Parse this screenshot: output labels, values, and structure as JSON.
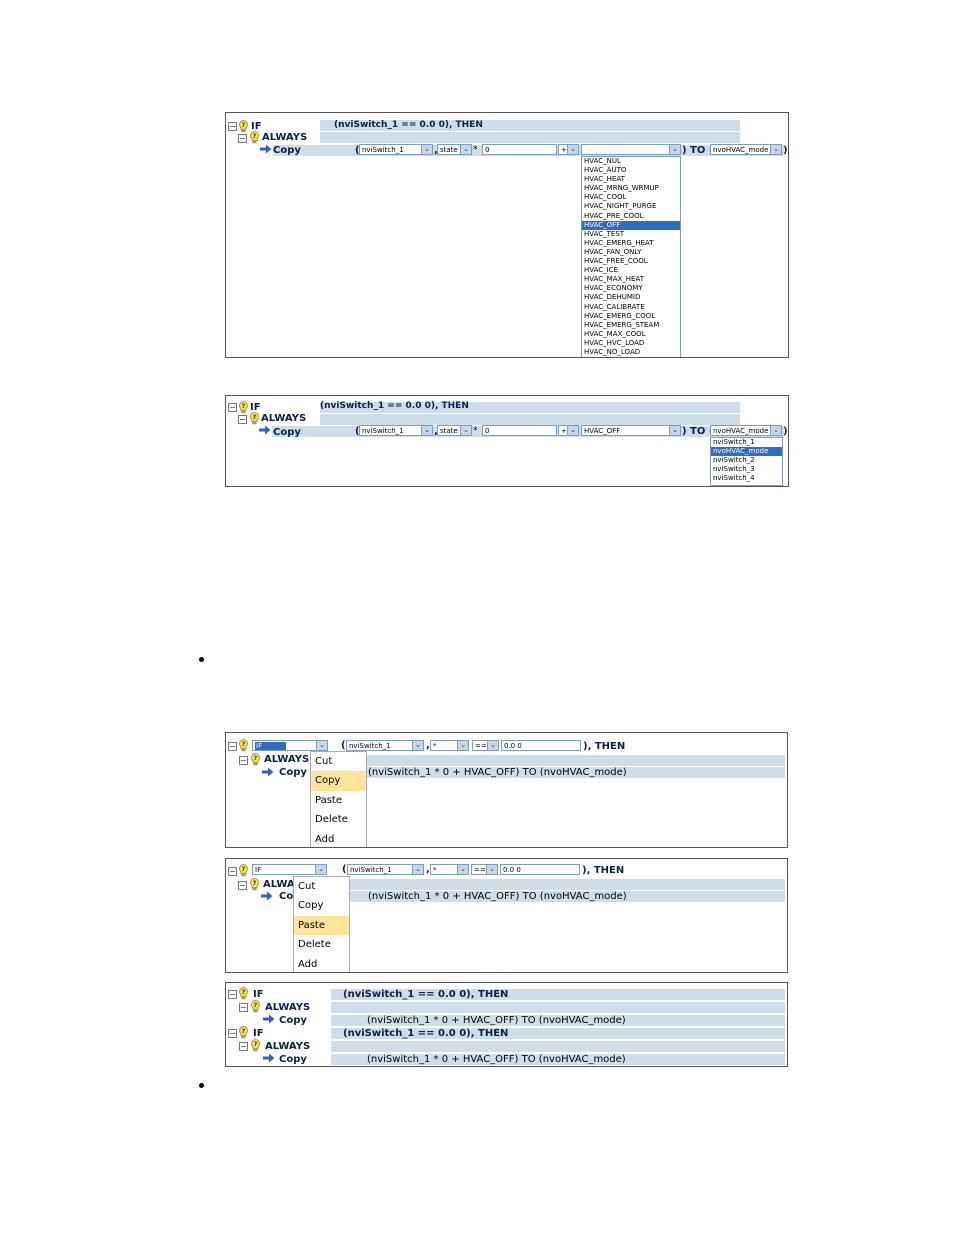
{
  "icons": {
    "bulb": "lightbulb-question-icon",
    "arrow": "arrow-right-icon",
    "expander": "collapse-minus-icon"
  },
  "colors": {
    "bar": "#cfdde8",
    "highlight": "#316ac5",
    "menu_highlight": "#ffe49c"
  },
  "p1": {
    "if_kw": "IF",
    "cond": "(nviSwitch_1 == 0.0 0), THEN",
    "always_kw": "ALWAYS",
    "copy_kw": "Copy",
    "open_paren": "(",
    "var": "nviSwitch_1",
    "comma": ",",
    "field": "state",
    "op1": "*",
    "num": "0",
    "op2": "+",
    "val": "",
    "to": ") TO (",
    "target": "nvoHVAC_mode",
    "close": ")",
    "options": [
      "HVAC_NUL",
      "HVAC_AUTO",
      "HVAC_HEAT",
      "HVAC_MRNG_WRMUP",
      "HVAC_COOL",
      "HVAC_NIGHT_PURGE",
      "HVAC_PRE_COOL",
      "HVAC_OFF",
      "HVAC_TEST",
      "HVAC_EMERG_HEAT",
      "HVAC_FAN_ONLY",
      "HVAC_FREE_COOL",
      "HVAC_ICE",
      "HVAC_MAX_HEAT",
      "HVAC_ECONOMY",
      "HVAC_DEHUMID",
      "HVAC_CALIBRATE",
      "HVAC_EMERG_COOL",
      "HVAC_EMERG_STEAM",
      "HVAC_MAX_COOL",
      "HVAC_HVC_LOAD",
      "HVAC_NO_LOAD"
    ]
  },
  "p2": {
    "if_kw": "IF",
    "cond": "(nviSwitch_1 == 0.0 0), THEN",
    "always_kw": "ALWAYS",
    "copy_kw": "Copy",
    "open_paren": "(",
    "var": "nviSwitch_1",
    "comma": ",",
    "field": "state",
    "op1": "*",
    "num": "0",
    "op2": "+",
    "val": "HVAC_OFF",
    "to": ") TO (",
    "target": "nvoHVAC_mode",
    "close": ")",
    "options": [
      "nviSwitch_1",
      "nvoHVAC_mode",
      "nviSwitch_2",
      "nviSwitch_3",
      "nviSwitch_4"
    ]
  },
  "p3": {
    "if_sel": "IF",
    "open_paren": "(",
    "var": "nviSwitch_1",
    "comma": ",",
    "field": "*",
    "op": "==",
    "num": "0.0 0",
    "then": "), THEN",
    "always_kw": "ALWAYS",
    "copy_kw": "Copy",
    "expr": "(nviSwitch_1 * 0 + HVAC_OFF) TO (nvoHVAC_mode)",
    "menu": [
      "Cut",
      "Copy",
      "Paste",
      "Delete",
      "Add"
    ]
  },
  "p4": {
    "if_sel": "IF",
    "open_paren": "(",
    "var": "nviSwitch_1",
    "comma": ",",
    "field": "*",
    "op": "==",
    "num": "0.0 0",
    "then": "), THEN",
    "always_kw": "ALWA",
    "copy_kw": "Co",
    "expr": "(nviSwitch_1 * 0 + HVAC_OFF) TO (nvoHVAC_mode)",
    "menu": [
      "Cut",
      "Copy",
      "Paste",
      "Delete",
      "Add"
    ]
  },
  "p5": {
    "if_kw": "IF",
    "cond": "(nviSwitch_1 == 0.0 0), THEN",
    "always_kw": "ALWAYS",
    "copy_kw": "Copy",
    "expr": "(nviSwitch_1 * 0 + HVAC_OFF) TO (nvoHVAC_mode)"
  }
}
